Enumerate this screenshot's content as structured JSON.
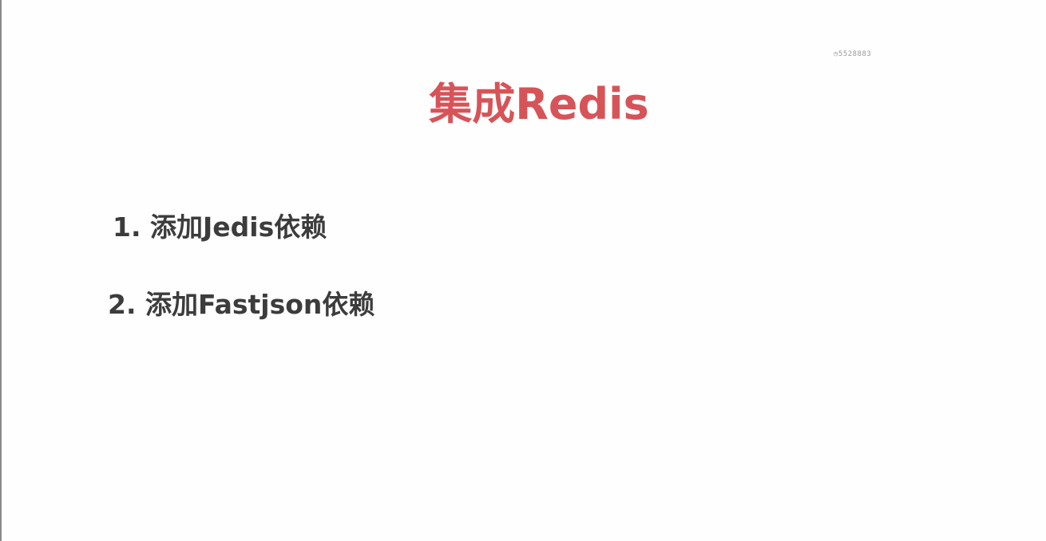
{
  "watermark": "◷5528883",
  "slide": {
    "title": "集成Redis",
    "items": [
      {
        "label": "1. 添加Jedis依赖"
      },
      {
        "label": "2. 添加Fastjson依赖"
      }
    ]
  },
  "colors": {
    "title": "#d65458",
    "body_text": "#3c3c3c",
    "background": "#fefefe"
  }
}
